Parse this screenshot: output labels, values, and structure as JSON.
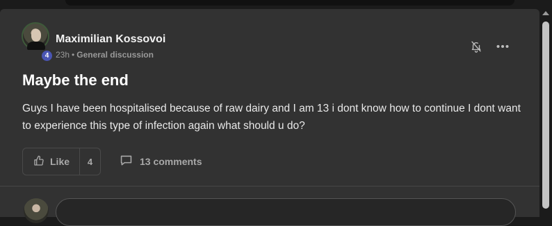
{
  "post": {
    "author": "Maximilian Kossovoi",
    "level": "4",
    "time": "23h",
    "separator": "•",
    "category": "General discussion",
    "title": "Maybe the end",
    "body": "Guys I have been hospitalised because of raw dairy and I am 13 i dont know how to continue I dont want to experience this type of infection again what should u do?"
  },
  "actions": {
    "like_label": "Like",
    "like_count": "4",
    "comments_label": "13 comments"
  },
  "icons": {
    "bell": "bell-off-icon",
    "more": "more-horizontal-icon",
    "like": "thumbs-up-icon",
    "comment": "comment-icon"
  },
  "colors": {
    "card_bg": "#323232",
    "page_bg": "#1b1b1b",
    "level_badge": "#4a55b3",
    "muted_text": "#9a9a9a"
  }
}
